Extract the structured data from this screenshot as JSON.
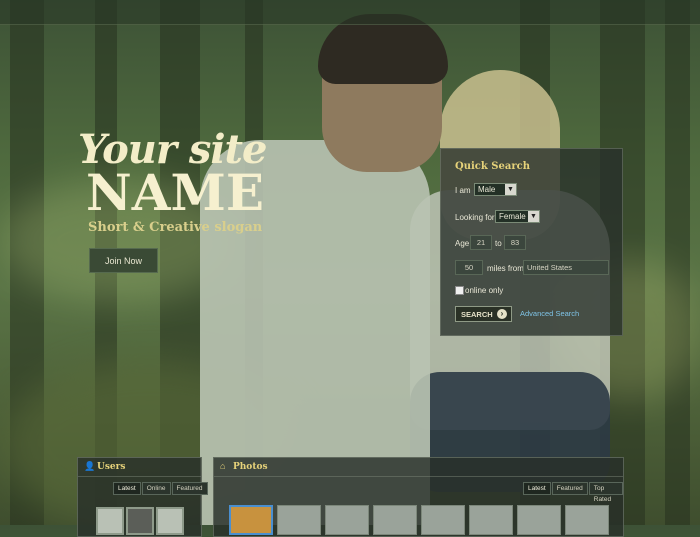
{
  "brand": {
    "script_name": "Your site",
    "name": "NAME",
    "slogan": "Short & Creative slogan",
    "join_label": "Join Now"
  },
  "quick_search": {
    "title": "Quick Search",
    "i_am_label": "I am",
    "i_am_value": "Male",
    "looking_for_label": "Looking for",
    "looking_for_value": "Female",
    "age_label": "Age",
    "age_from": "21",
    "age_to_label": "to",
    "age_to": "83",
    "miles_value": "50",
    "miles_from_label": "miles from",
    "country_value": "United States",
    "online_only_label": "online only",
    "online_only_checked": false,
    "search_label": "SEARCH",
    "advanced_label": "Advanced Search"
  },
  "users_panel": {
    "title": "Users",
    "tabs": [
      "Latest",
      "Online",
      "Featured"
    ],
    "active_tab": "Latest"
  },
  "photos_panel": {
    "title": "Photos",
    "tabs": [
      "Latest",
      "Featured",
      "Top Rated"
    ],
    "active_tab": "Latest"
  },
  "colors": {
    "accent_gold": "#e6d27a",
    "link_blue": "#7fc3e6",
    "title_cream": "#f6f0cf"
  },
  "icons": {
    "users": "user-icon",
    "photos": "home-icon",
    "search": "arrow-right-circle-icon",
    "select": "chevron-down-icon"
  }
}
